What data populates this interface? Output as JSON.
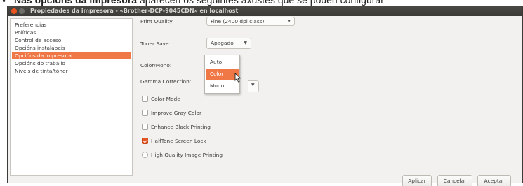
{
  "caption": {
    "bold_text": "Nas opcións da impresora",
    "rest_text": " aparecen os seguintes axustes que se poden configurar"
  },
  "window": {
    "title": "Propiedades da impresora - «Brother-DCP-9045CDN» en localhost"
  },
  "sidebar": {
    "items": [
      {
        "label": "Preferencias"
      },
      {
        "label": "Políticas"
      },
      {
        "label": "Control de acceso"
      },
      {
        "label": "Opcións instalábeis"
      },
      {
        "label": "Opcións da impresora"
      },
      {
        "label": "Opcións do traballo"
      },
      {
        "label": "Niveis de tinta/tóner"
      }
    ],
    "selected_index": 4
  },
  "options": {
    "print_quality": {
      "label": "Print Quality:",
      "value": "Fine (2400 dpi class)"
    },
    "toner_save": {
      "label": "Toner Save:",
      "value": "Apagado"
    },
    "color_mono": {
      "label": "Color/Mono:"
    },
    "gamma": {
      "label": "Gamma Correction:"
    },
    "checkboxes": [
      {
        "label": "Color Mode",
        "checked": false
      },
      {
        "label": "Improve Gray Color",
        "checked": false
      },
      {
        "label": "Enhance Black Printing",
        "checked": false
      },
      {
        "label": "HalfTone Screen Lock",
        "checked": true
      }
    ],
    "radio": {
      "label": "High Quality Image Printing"
    }
  },
  "popup": {
    "items": [
      "Auto",
      "Color",
      "Mono"
    ],
    "hover_index": 1
  },
  "footer": {
    "apply": "Aplicar",
    "cancel": "Cancelar",
    "ok": "Aceptar"
  },
  "colors": {
    "accent": "#f07746",
    "titlebar": "#3c3b37",
    "close_button": "#e9541e"
  }
}
